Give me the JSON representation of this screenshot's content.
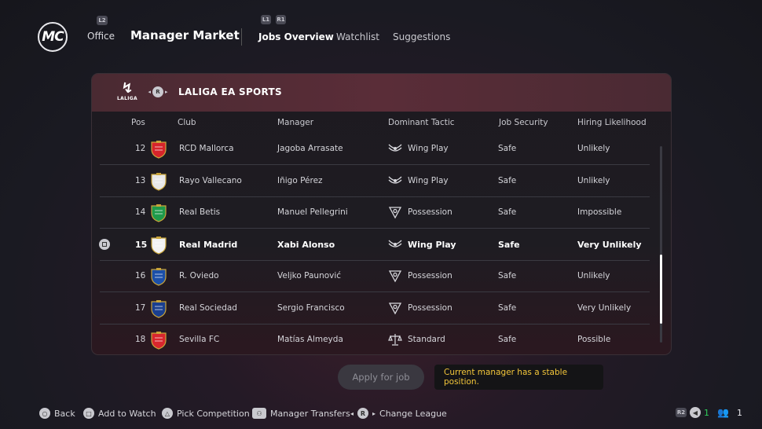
{
  "header": {
    "logo_text": "MC",
    "office": "Office",
    "office_hint": "L2",
    "title": "Manager Market",
    "tabs": [
      {
        "label": "Jobs Overview",
        "active": true
      },
      {
        "label": "Watchlist",
        "active": false
      },
      {
        "label": "Suggestions",
        "active": false
      }
    ],
    "tab_hint_left": "L1",
    "tab_hint_right": "R1"
  },
  "league": {
    "logo_text": "LALIGA",
    "switch_hint": "R",
    "name": "LALIGA EA SPORTS"
  },
  "columns": [
    "Pos",
    "Club",
    "Manager",
    "Dominant Tactic",
    "Job Security",
    "Hiring Likelihood"
  ],
  "rows": [
    {
      "pos": "12",
      "club": "RCD Mallorca",
      "manager": "Jagoba Arrasate",
      "tactic": "Wing Play",
      "security": "Safe",
      "likelihood": "Unlikely",
      "crest_color": "#d6242b",
      "tactic_icon": "wing-play-icon"
    },
    {
      "pos": "13",
      "club": "Rayo Vallecano",
      "manager": "Iñigo Pérez",
      "tactic": "Wing Play",
      "security": "Safe",
      "likelihood": "Unlikely",
      "crest_color": "#e8e8e8",
      "tactic_icon": "wing-play-icon"
    },
    {
      "pos": "14",
      "club": "Real Betis",
      "manager": "Manuel Pellegrini",
      "tactic": "Possession",
      "security": "Safe",
      "likelihood": "Impossible",
      "crest_color": "#1f9a4b",
      "tactic_icon": "possession-icon"
    },
    {
      "pos": "15",
      "club": "Real Madrid",
      "manager": "Xabi Alonso",
      "tactic": "Wing Play",
      "security": "Safe",
      "likelihood": "Very Unlikely",
      "crest_color": "#f2f2f2",
      "tactic_icon": "wing-play-icon",
      "selected": true
    },
    {
      "pos": "16",
      "club": "R. Oviedo",
      "manager": "Veljko Paunović",
      "tactic": "Possession",
      "security": "Safe",
      "likelihood": "Unlikely",
      "crest_color": "#1b4fa8",
      "tactic_icon": "possession-icon"
    },
    {
      "pos": "17",
      "club": "Real Sociedad",
      "manager": "Sergio Francisco",
      "tactic": "Possession",
      "security": "Safe",
      "likelihood": "Very Unlikely",
      "crest_color": "#1a3f8f",
      "tactic_icon": "possession-icon"
    },
    {
      "pos": "18",
      "club": "Sevilla FC",
      "manager": "Matías Almeyda",
      "tactic": "Standard",
      "security": "Safe",
      "likelihood": "Possible",
      "crest_color": "#d8262e",
      "tactic_icon": "standard-icon"
    }
  ],
  "apply_button": "Apply for job",
  "tooltip": "Current manager has a stable position.",
  "footer": {
    "hints": [
      {
        "label": "Back",
        "glyph": "○"
      },
      {
        "label": "Add to Watch",
        "glyph": "□"
      },
      {
        "label": "Pick Competition",
        "glyph": "△"
      },
      {
        "label": "Manager Transfers",
        "glyph": "⚇"
      },
      {
        "label": "Change League",
        "glyph": "R"
      }
    ],
    "status_r2": "R2",
    "status_green": "1",
    "status_count": "1"
  },
  "colors": {
    "accent_yellow": "#f3c63a",
    "green": "#2fce5b"
  }
}
